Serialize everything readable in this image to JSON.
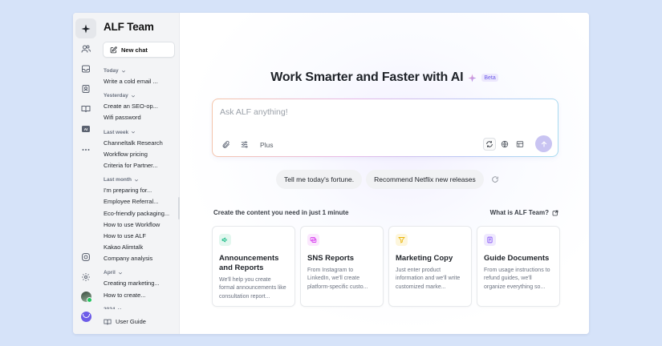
{
  "rail": {
    "icons": [
      "sparkle-icon",
      "people-icon",
      "inbox-icon",
      "contacts-icon",
      "book-icon",
      "ai-icon",
      "more-icon"
    ],
    "bottom_icons": [
      "bot-icon",
      "gear-icon",
      "avatar",
      "team-logo"
    ]
  },
  "sidebar": {
    "title": "ALF Team",
    "new_chat_label": "New chat",
    "groups": [
      {
        "label": "Today",
        "items": [
          "Write a cold email ..."
        ]
      },
      {
        "label": "Yesterday",
        "items": [
          "Create an SEO-op...",
          "Wifi password"
        ]
      },
      {
        "label": "Last week",
        "items": [
          "Channeltalk Research",
          "Workflow pricing",
          "Criteria for Partner..."
        ]
      },
      {
        "label": "Last month",
        "items": [
          "I'm preparing for...",
          "Employee Referral...",
          "Eco-friendly packaging...",
          "How to use Workflow",
          "How to use ALF",
          "Kakao Alimtalk",
          "Company analysis"
        ]
      },
      {
        "label": "April",
        "items": [
          "Creating marketing...",
          "How to create..."
        ]
      },
      {
        "label": "2024",
        "items": []
      }
    ],
    "user_guide_label": "User Guide"
  },
  "main": {
    "hero_title": "Work Smarter and Faster with AI",
    "beta_badge": "Beta",
    "ask_placeholder": "Ask ALF anything!",
    "plus_label": "Plus",
    "suggestions": [
      "Tell me today's fortune.",
      "Recommend Netflix new releases"
    ],
    "section_title": "Create the content you need in just 1 minute",
    "what_is_link": "What is ALF Team?",
    "cards": [
      {
        "title": "Announcements and Reports",
        "desc": "We'll help you create formal announcements like consultation report...",
        "icon": "megaphone-icon",
        "color": "#10b981",
        "bg": "#e3f7ef"
      },
      {
        "title": "SNS Reports",
        "desc": "From Instagram to LinkedIn, we'll create platform-specific custo...",
        "icon": "chat-icon",
        "color": "#d946ef",
        "bg": "#fbe8fd"
      },
      {
        "title": "Marketing Copy",
        "desc": "Just enter product information and we'll write customized marke...",
        "icon": "funnel-icon",
        "color": "#eab308",
        "bg": "#fdf6dc"
      },
      {
        "title": "Guide Documents",
        "desc": "From usage instructions to refund guides, we'll organize everything so...",
        "icon": "document-icon",
        "color": "#8b5cf6",
        "bg": "#efe9fe"
      }
    ]
  },
  "colors": {
    "background": "#d6e3f9",
    "accent": "#6d5ce8",
    "send_button": "#c9c4f2"
  }
}
